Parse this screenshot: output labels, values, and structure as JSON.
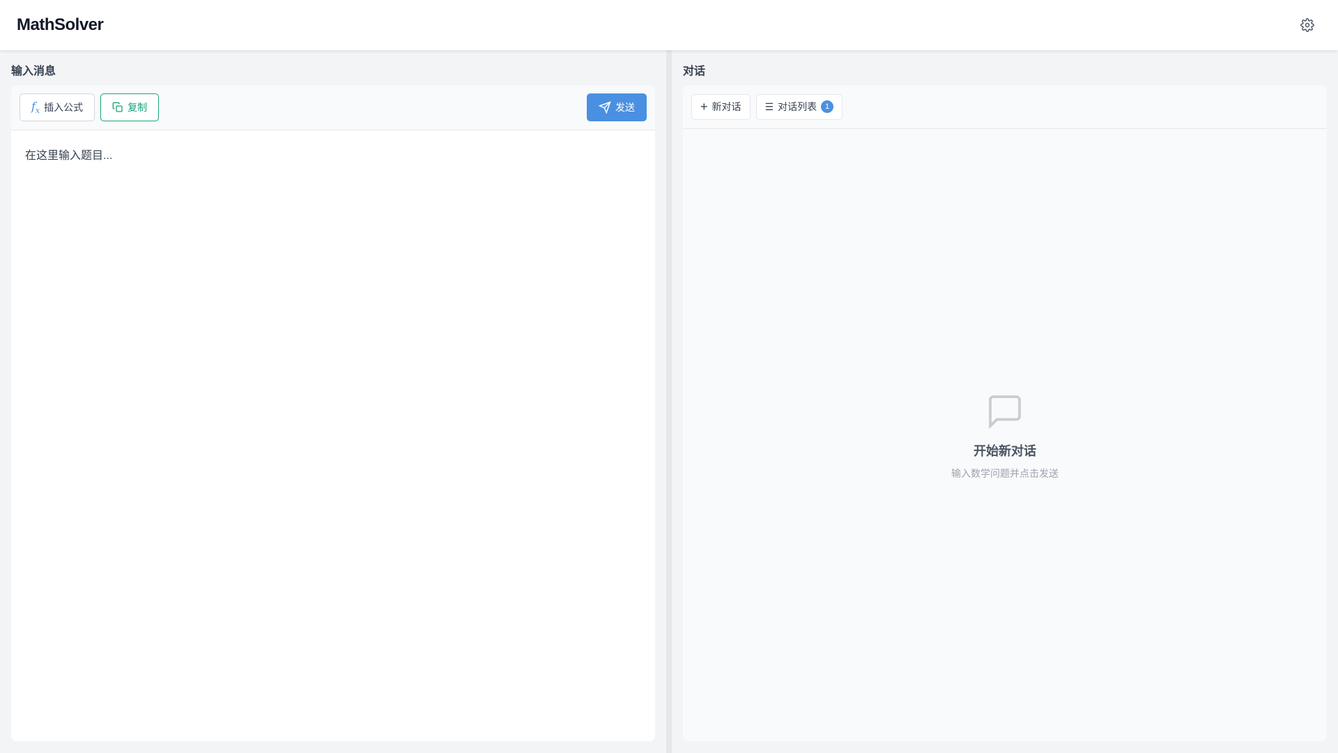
{
  "header": {
    "title": "MathSolver",
    "settings_icon": "gear-icon"
  },
  "left": {
    "title": "输入消息",
    "insert_formula": "插入公式",
    "copy": "复制",
    "send": "发送",
    "placeholder": "在这里输入题目..."
  },
  "right": {
    "title": "对话",
    "new_chat": "新对话",
    "chat_list": "对话列表",
    "chat_count": "1",
    "empty_title": "开始新对话",
    "empty_subtitle": "输入数学问题并点击发送"
  },
  "colors": {
    "accent": "#4a90e2",
    "copy_green": "#16a37a"
  }
}
